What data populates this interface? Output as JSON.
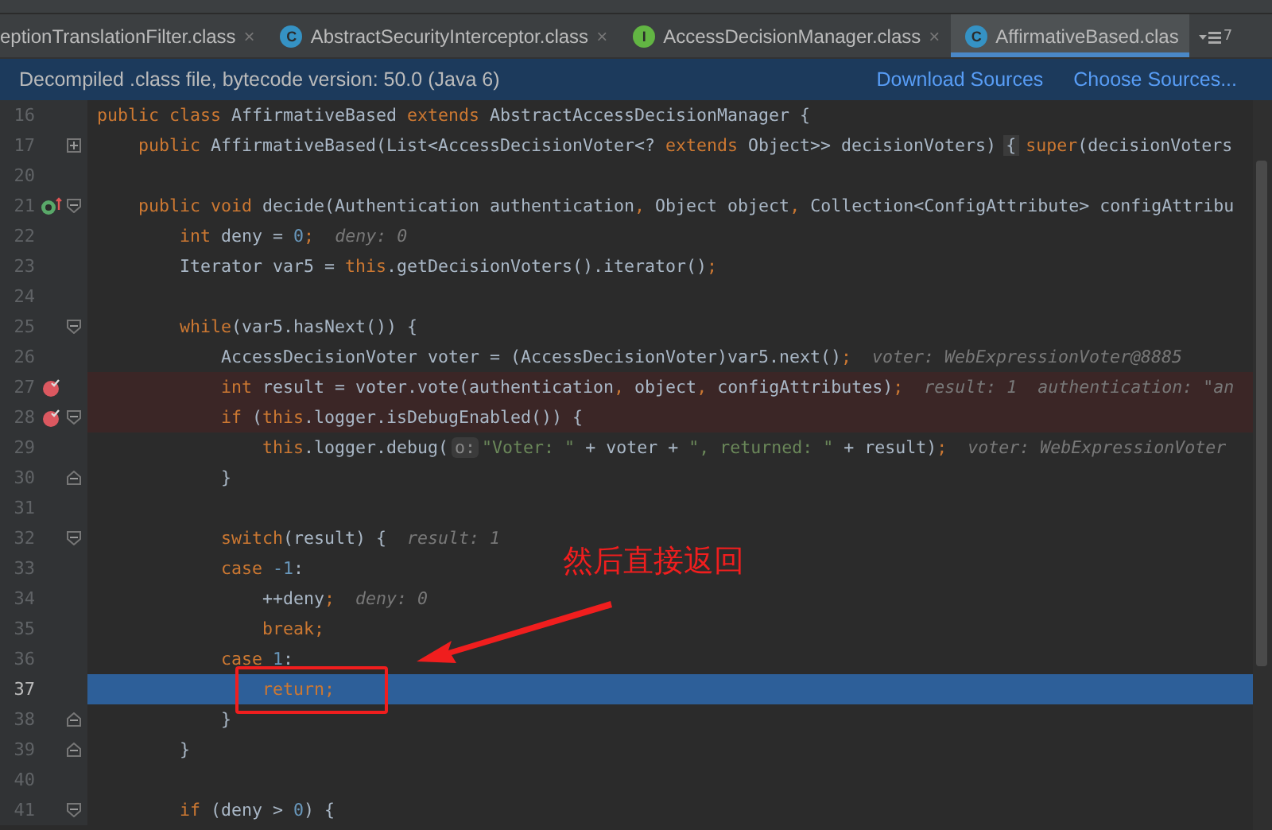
{
  "tabs": [
    {
      "label": "eptionTranslationFilter.class",
      "kind": "none",
      "close": "×",
      "selected": false
    },
    {
      "label": "AbstractSecurityInterceptor.class",
      "kind": "class",
      "icon": "C",
      "close": "×",
      "selected": false
    },
    {
      "label": "AccessDecisionManager.class",
      "kind": "interface",
      "icon": "I",
      "close": "×",
      "selected": false
    },
    {
      "label": "AffirmativeBased.clas",
      "kind": "class",
      "icon": "C",
      "selected": true
    }
  ],
  "overflow_count": "7",
  "banner": {
    "message": "Decompiled .class file, bytecode version: 50.0 (Java 6)",
    "actions": [
      "Download Sources",
      "Choose Sources..."
    ]
  },
  "lines": [
    {
      "number": "16",
      "kind": "normal",
      "segments": [
        {
          "kind": "code",
          "parts": [
            {
              "kind": "keyword",
              "text": "public class"
            },
            {
              "kind": "plain",
              "text": " AffirmativeBased "
            },
            {
              "kind": "keyword",
              "text": "extends"
            },
            {
              "kind": "plain",
              "text": " AbstractAccessDecisionManager {"
            }
          ]
        }
      ]
    },
    {
      "number": "17",
      "kind": "normal",
      "fold": {
        "kind": "collapsed"
      },
      "segments": [
        {
          "kind": "code",
          "parts": [
            {
              "kind": "keyword",
              "text": "    public"
            },
            {
              "kind": "plain",
              "text": " AffirmativeBased(List<AccessDecisionVoter<? "
            },
            {
              "kind": "keyword",
              "text": "extends"
            },
            {
              "kind": "plain",
              "text": " Object>> decisionVoters)"
            }
          ]
        },
        {
          "kind": "fold",
          "text": "{"
        },
        {
          "kind": "code",
          "parts": [
            {
              "kind": "keyword",
              "text": "super"
            },
            {
              "kind": "plain",
              "text": "(decisionVoters"
            }
          ]
        }
      ]
    },
    {
      "number": "20",
      "kind": "normal"
    },
    {
      "number": "21",
      "kind": "override",
      "fold": {
        "kind": "start"
      },
      "segments": [
        {
          "kind": "code",
          "parts": [
            {
              "kind": "keyword",
              "text": "    public void"
            },
            {
              "kind": "plain",
              "text": " decide(Authentication authentication"
            },
            {
              "kind": "keyword",
              "text": ","
            },
            {
              "kind": "plain",
              "text": " Object object"
            },
            {
              "kind": "keyword",
              "text": ","
            },
            {
              "kind": "plain",
              "text": " Collection<ConfigAttribute> configAttribu"
            }
          ]
        }
      ]
    },
    {
      "number": "22",
      "kind": "normal",
      "segments": [
        {
          "kind": "code",
          "parts": [
            {
              "kind": "keyword",
              "text": "        int"
            },
            {
              "kind": "plain",
              "text": " deny = "
            },
            {
              "kind": "number",
              "text": "0"
            },
            {
              "kind": "keyword",
              "text": ";"
            }
          ]
        },
        {
          "kind": "hint",
          "text": "deny: 0"
        }
      ]
    },
    {
      "number": "23",
      "kind": "normal",
      "segments": [
        {
          "kind": "code",
          "parts": [
            {
              "kind": "plain",
              "text": "        Iterator var5 = "
            },
            {
              "kind": "keyword",
              "text": "this"
            },
            {
              "kind": "plain",
              "text": ".getDecisionVoters().iterator()"
            },
            {
              "kind": "keyword",
              "text": ";"
            }
          ]
        }
      ]
    },
    {
      "number": "24",
      "kind": "normal"
    },
    {
      "number": "25",
      "kind": "normal",
      "fold": {
        "kind": "start"
      },
      "segments": [
        {
          "kind": "code",
          "parts": [
            {
              "kind": "keyword",
              "text": "        while"
            },
            {
              "kind": "plain",
              "text": "(var5.hasNext()) {"
            }
          ]
        }
      ]
    },
    {
      "number": "26",
      "kind": "normal",
      "segments": [
        {
          "kind": "code",
          "parts": [
            {
              "kind": "plain",
              "text": "            AccessDecisionVoter voter = (AccessDecisionVoter)var5.next()"
            },
            {
              "kind": "keyword",
              "text": ";"
            }
          ]
        },
        {
          "kind": "hint",
          "text": "voter: WebExpressionVoter@8885"
        }
      ]
    },
    {
      "number": "27",
      "kind": "breakpoint",
      "segments": [
        {
          "kind": "code",
          "parts": [
            {
              "kind": "keyword",
              "text": "            int"
            },
            {
              "kind": "plain",
              "text": " result = voter.vote(authentication"
            },
            {
              "kind": "keyword",
              "text": ","
            },
            {
              "kind": "plain",
              "text": " object"
            },
            {
              "kind": "keyword",
              "text": ","
            },
            {
              "kind": "plain",
              "text": " configAttributes)"
            },
            {
              "kind": "keyword",
              "text": ";"
            }
          ]
        },
        {
          "kind": "hint",
          "text": "result: 1"
        },
        {
          "kind": "hint",
          "text": "authentication: \"an"
        }
      ]
    },
    {
      "number": "28",
      "kind": "breakpoint",
      "fold": {
        "kind": "start"
      },
      "segments": [
        {
          "kind": "code",
          "parts": [
            {
              "kind": "keyword",
              "text": "            if"
            },
            {
              "kind": "plain",
              "text": " ("
            },
            {
              "kind": "keyword",
              "text": "this"
            },
            {
              "kind": "plain",
              "text": ".logger.isDebugEnabled()) {"
            }
          ]
        }
      ]
    },
    {
      "number": "29",
      "kind": "normal",
      "segments": [
        {
          "kind": "code",
          "parts": [
            {
              "kind": "keyword",
              "text": "                this"
            },
            {
              "kind": "plain",
              "text": ".logger.debug("
            }
          ]
        },
        {
          "kind": "param",
          "text": "o:"
        },
        {
          "kind": "code",
          "parts": [
            {
              "kind": "string",
              "text": "\"Voter: \""
            },
            {
              "kind": "plain",
              "text": " + voter + "
            },
            {
              "kind": "string",
              "text": "\", returned: \""
            },
            {
              "kind": "plain",
              "text": " + result)"
            },
            {
              "kind": "keyword",
              "text": ";"
            }
          ]
        },
        {
          "kind": "hint",
          "text": "voter: WebExpressionVoter"
        }
      ]
    },
    {
      "number": "30",
      "kind": "normal",
      "fold": {
        "kind": "end"
      },
      "segments": [
        {
          "kind": "code",
          "parts": [
            {
              "kind": "plain",
              "text": "            }"
            }
          ]
        }
      ]
    },
    {
      "number": "31",
      "kind": "normal"
    },
    {
      "number": "32",
      "kind": "normal",
      "fold": {
        "kind": "start"
      },
      "segments": [
        {
          "kind": "code",
          "parts": [
            {
              "kind": "keyword",
              "text": "            switch"
            },
            {
              "kind": "plain",
              "text": "(result) {"
            }
          ]
        },
        {
          "kind": "hint",
          "text": "result: 1"
        }
      ]
    },
    {
      "number": "33",
      "kind": "normal",
      "segments": [
        {
          "kind": "code",
          "parts": [
            {
              "kind": "keyword",
              "text": "            case"
            },
            {
              "kind": "number",
              "text": " -1"
            },
            {
              "kind": "plain",
              "text": ":"
            }
          ]
        }
      ]
    },
    {
      "number": "34",
      "kind": "normal",
      "segments": [
        {
          "kind": "code",
          "parts": [
            {
              "kind": "plain",
              "text": "                ++deny"
            },
            {
              "kind": "keyword",
              "text": ";"
            }
          ]
        },
        {
          "kind": "hint",
          "text": "deny: 0"
        }
      ]
    },
    {
      "number": "35",
      "kind": "normal",
      "segments": [
        {
          "kind": "code",
          "parts": [
            {
              "kind": "keyword",
              "text": "                break;"
            }
          ]
        }
      ]
    },
    {
      "number": "36",
      "kind": "normal",
      "segments": [
        {
          "kind": "code",
          "parts": [
            {
              "kind": "keyword",
              "text": "            case"
            },
            {
              "kind": "number",
              "text": " 1"
            },
            {
              "kind": "plain",
              "text": ":"
            }
          ]
        }
      ]
    },
    {
      "number": "37",
      "kind": "current",
      "segments": [
        {
          "kind": "code",
          "parts": [
            {
              "kind": "keyword",
              "text": "                return;"
            }
          ]
        }
      ]
    },
    {
      "number": "38",
      "kind": "normal",
      "fold": {
        "kind": "end"
      },
      "segments": [
        {
          "kind": "code",
          "parts": [
            {
              "kind": "plain",
              "text": "            }"
            }
          ]
        }
      ]
    },
    {
      "number": "39",
      "kind": "normal",
      "fold": {
        "kind": "end"
      },
      "segments": [
        {
          "kind": "code",
          "parts": [
            {
              "kind": "plain",
              "text": "        }"
            }
          ]
        }
      ]
    },
    {
      "number": "40",
      "kind": "normal"
    },
    {
      "number": "41",
      "kind": "normal",
      "fold": {
        "kind": "start"
      },
      "segments": [
        {
          "kind": "code",
          "parts": [
            {
              "kind": "keyword",
              "text": "        if"
            },
            {
              "kind": "plain",
              "text": " (deny > "
            },
            {
              "kind": "number",
              "text": "0"
            },
            {
              "kind": "plain",
              "text": ") {"
            }
          ]
        }
      ]
    }
  ],
  "annotation": {
    "text": "然后直接返回"
  }
}
